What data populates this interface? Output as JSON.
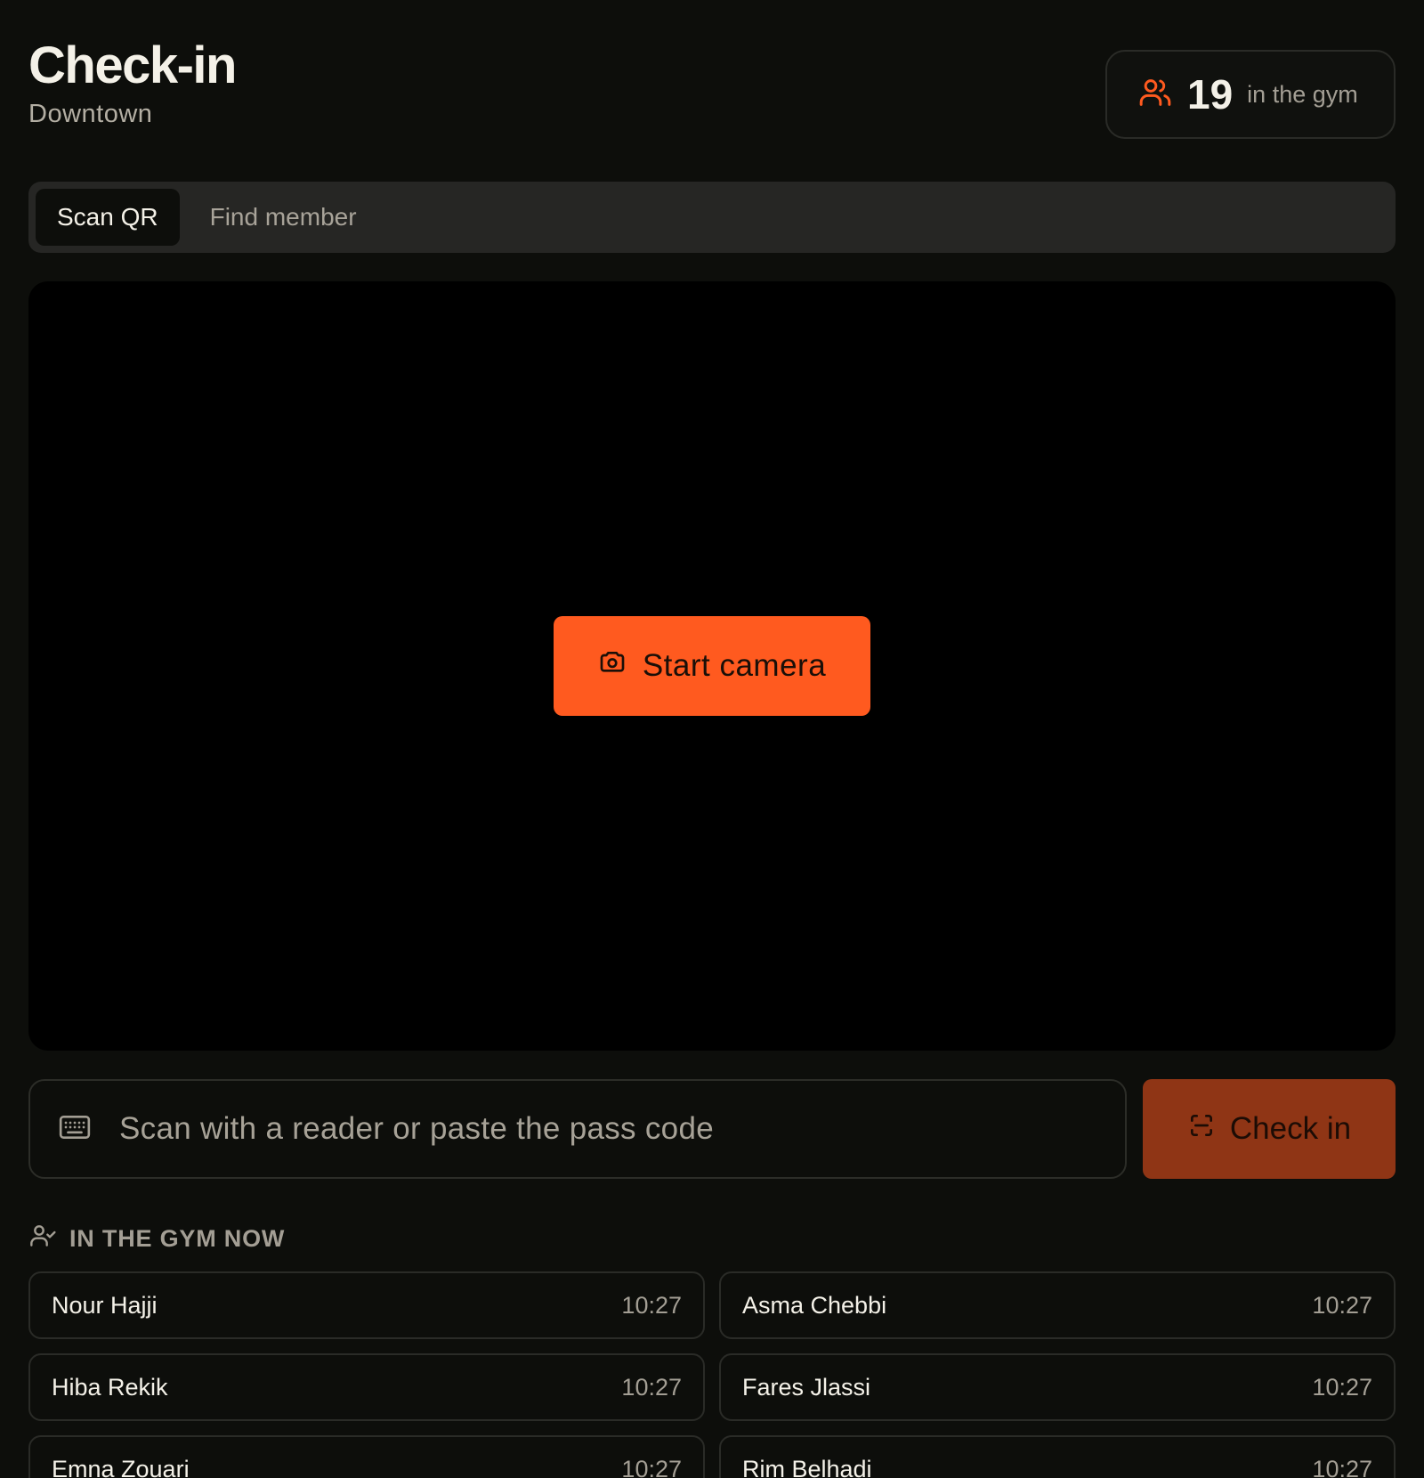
{
  "header": {
    "title": "Check-in",
    "location": "Downtown",
    "count": "19",
    "count_label": "in the gym",
    "count_icon": "users-icon"
  },
  "tabs": [
    {
      "label": "Scan QR",
      "active": true
    },
    {
      "label": "Find member",
      "active": false
    }
  ],
  "camera": {
    "start_label": "Start camera",
    "icon": "camera-icon"
  },
  "pass_code": {
    "placeholder": "Scan with a reader or paste the pass code",
    "icon": "keyboard-icon",
    "submit_label": "Check in",
    "submit_icon": "scan-icon"
  },
  "section": {
    "title": "IN THE GYM NOW",
    "icon": "user-check-icon"
  },
  "members": [
    {
      "name": "Nour Hajji",
      "time": "10:27"
    },
    {
      "name": "Asma Chebbi",
      "time": "10:27"
    },
    {
      "name": "Hiba Rekik",
      "time": "10:27"
    },
    {
      "name": "Fares Jlassi",
      "time": "10:27"
    },
    {
      "name": "Emna Zouari",
      "time": "10:27"
    },
    {
      "name": "Rim Belhadi",
      "time": "10:27"
    }
  ],
  "colors": {
    "accent": "#ff5a1f",
    "accent_dark": "#8f3515",
    "background": "#0d0e0b"
  }
}
